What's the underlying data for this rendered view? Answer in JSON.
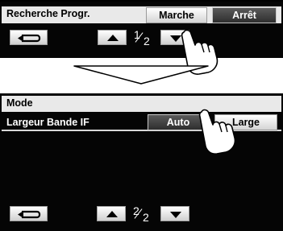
{
  "screen1": {
    "setting_label": "Recherche Progr.",
    "options": [
      "Marche",
      "Arrêt"
    ],
    "page_num": "1",
    "page_den": "2"
  },
  "screen2": {
    "title": "Mode",
    "setting_label": "Largeur Bande IF",
    "options": [
      "Auto",
      "Large"
    ],
    "page_num": "2",
    "page_den": "2"
  },
  "icons": {
    "back": "back-arrow-icon",
    "up": "up-triangle-icon",
    "down": "down-triangle-icon",
    "pointer": "pointing-hand-icon",
    "transition": "down-arrow-icon"
  },
  "colors": {
    "panel_bg": "#050505",
    "row_bg": "#e9e9e9",
    "button_light": "#ffffff",
    "button_dark": "#3a3a3a"
  }
}
